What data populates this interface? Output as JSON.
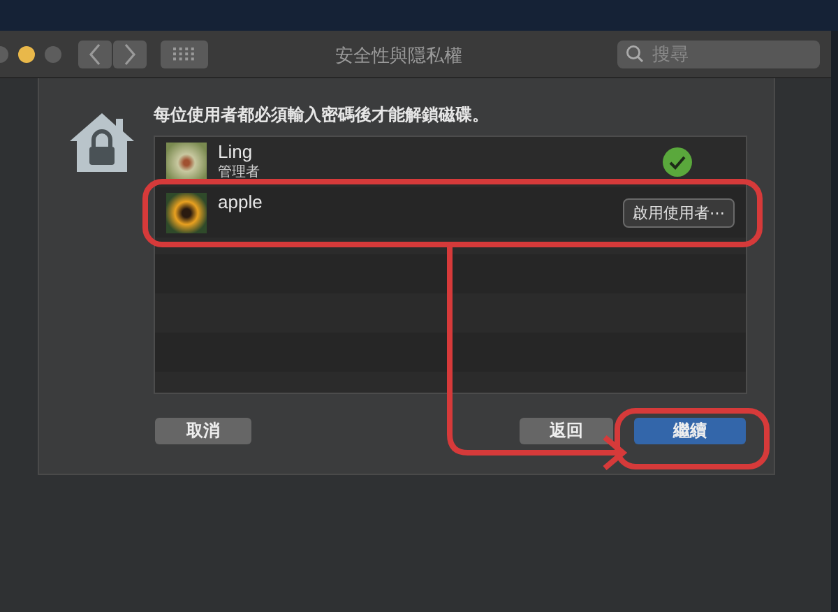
{
  "window": {
    "title": "安全性與隱私權",
    "search": {
      "placeholder": "搜尋"
    }
  },
  "sheet": {
    "message": "每位使用者都必須輸入密碼後才能解鎖磁碟。",
    "users": [
      {
        "name": "Ling",
        "role": "管理者",
        "kind": "enabled"
      },
      {
        "name": "apple",
        "kind": "action",
        "action": "啟用使用者⋯"
      }
    ],
    "buttons": [
      {
        "label": "取消",
        "default": false
      },
      {
        "label": "返回",
        "default": false
      },
      {
        "label": "繼續",
        "default": true
      }
    ]
  }
}
